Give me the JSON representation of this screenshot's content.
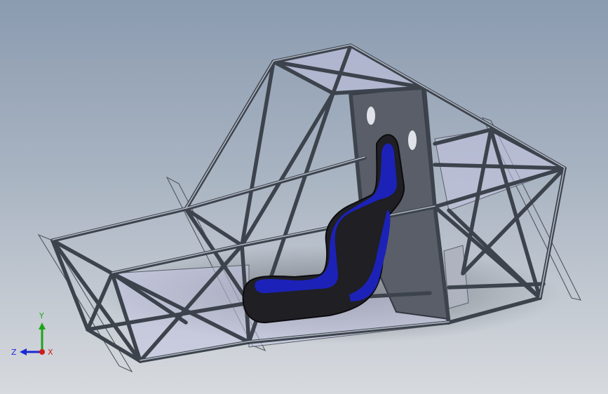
{
  "viewport": {
    "background_top": "#8b9bb0",
    "background_bottom": "#d7dade",
    "tube_color": "#3d434c",
    "panel_color": "#c4c4e2",
    "seat_color": "#1f1f24",
    "seat_accent": "#1c22b8"
  },
  "triad": {
    "x_label": "X",
    "y_label": "Y",
    "z_label": "Z",
    "x_color": "#d21a1a",
    "y_color": "#1aa51a",
    "z_color": "#1a2ad2"
  }
}
